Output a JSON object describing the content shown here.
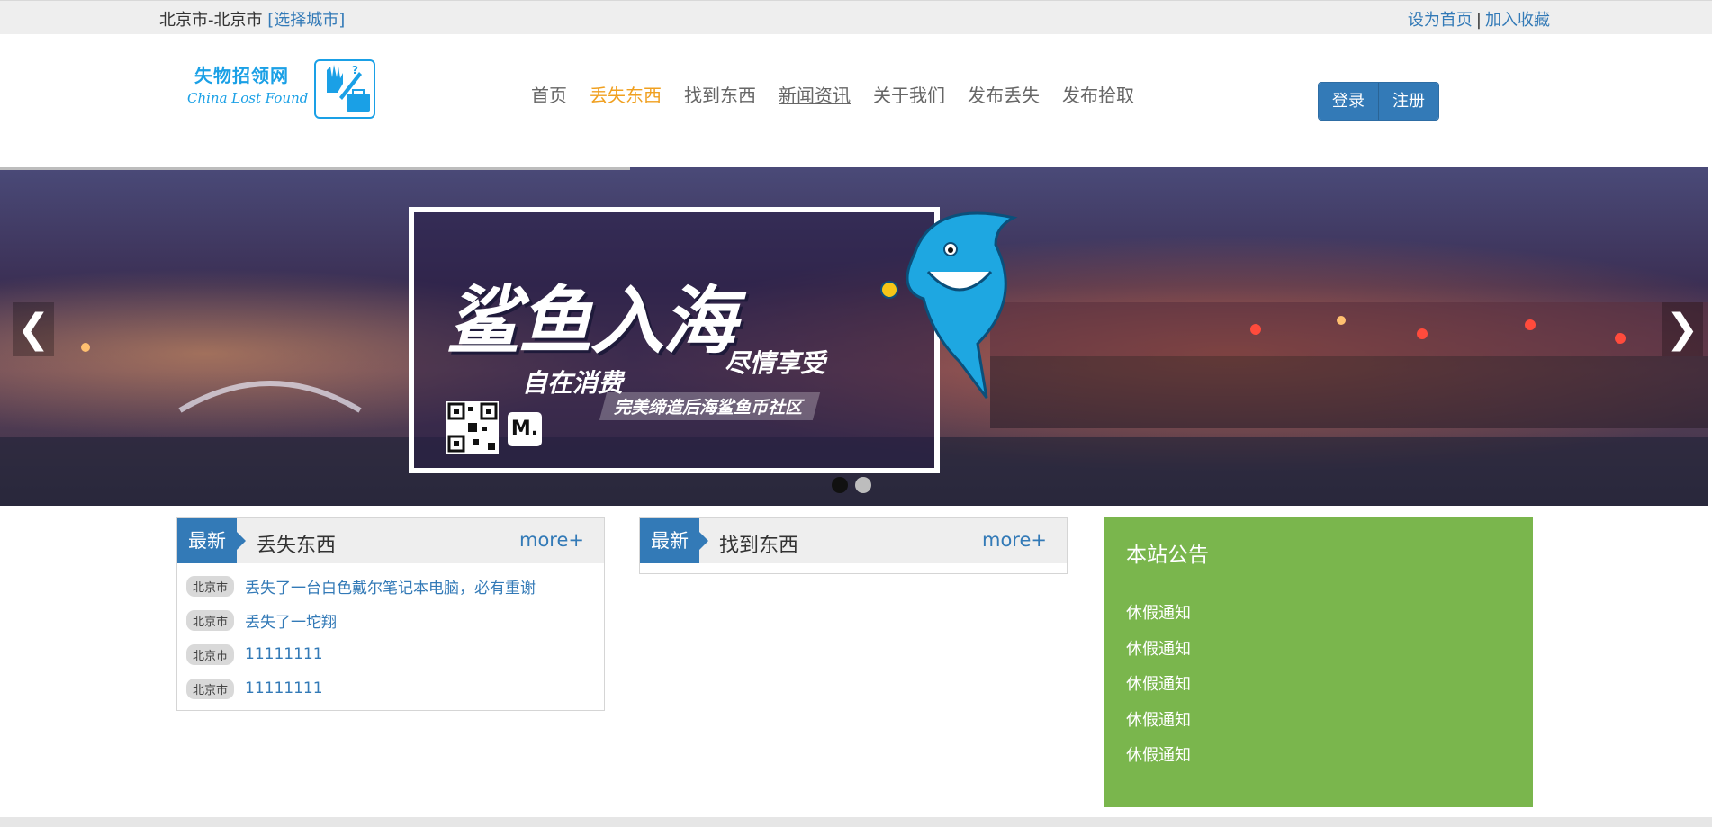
{
  "topbar": {
    "location": "北京市-北京市",
    "select_city": "[选择城市]",
    "set_home": "设为首页",
    "separator": "|",
    "add_favorite": "加入收藏"
  },
  "logo": {
    "cn": "失物招领网",
    "en": "China Lost Found"
  },
  "nav": {
    "items": [
      "首页",
      "丢失东西",
      "找到东西",
      "新闻资讯",
      "关于我们",
      "发布丢失",
      "发布拾取"
    ],
    "active_color": "#f0a020"
  },
  "auth": {
    "login": "登录",
    "register": "注册"
  },
  "banner": {
    "headline": "鲨鱼入海",
    "sub_left": "自在消费",
    "sub_right": "尽情享受",
    "tagline": "完美缔造后海鲨鱼币社区",
    "badge_letter": "M.",
    "prev": "❮",
    "next": "❯",
    "slides": 2,
    "current_slide": 1
  },
  "lost_panel": {
    "ribbon": "最新",
    "title": "丢失东西",
    "more": "more+",
    "items": [
      {
        "tag": "北京市",
        "text": "丢失了一台白色戴尔笔记本电脑，必有重谢"
      },
      {
        "tag": "北京市",
        "text": "丢失了一坨翔"
      },
      {
        "tag": "北京市",
        "text": "11111111"
      },
      {
        "tag": "北京市",
        "text": "11111111"
      }
    ]
  },
  "found_panel": {
    "ribbon": "最新",
    "title": "找到东西",
    "more": "more+"
  },
  "notice": {
    "title": "本站公告",
    "items": [
      "休假通知",
      "休假通知",
      "休假通知",
      "休假通知",
      "休假通知"
    ]
  },
  "colors": {
    "primary": "#337ab7",
    "notice_bg": "#7ab64d",
    "logo": "#1aa0e6"
  }
}
